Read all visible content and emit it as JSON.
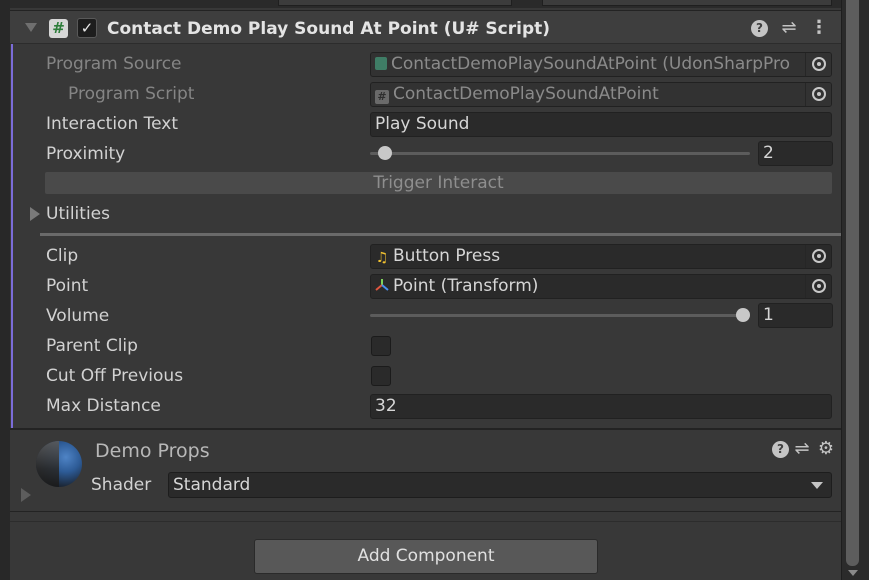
{
  "component": {
    "title": "Contact Demo Play Sound At Point (U# Script)",
    "enabled": true,
    "icons": {
      "script": "csharp-hash-icon",
      "help": "help-icon",
      "presets": "sliders-icon",
      "menu": "kebab-menu-icon"
    }
  },
  "udon": {
    "program_source_label": "Program Source",
    "program_source_value": "ContactDemoPlaySoundAtPoint (UdonSharpPro",
    "program_script_label": "Program Script",
    "program_script_value": "ContactDemoPlaySoundAtPoint",
    "interaction_text_label": "Interaction Text",
    "interaction_text_value": "Play Sound",
    "proximity_label": "Proximity",
    "proximity_value": "2",
    "trigger_button": "Trigger Interact",
    "utilities_label": "Utilities"
  },
  "fields": {
    "clip_label": "Clip",
    "clip_value": "Button Press",
    "point_label": "Point",
    "point_value": "Point (Transform)",
    "volume_label": "Volume",
    "volume_value": "1",
    "parent_clip_label": "Parent Clip",
    "parent_clip_checked": false,
    "cut_off_label": "Cut Off Previous",
    "cut_off_checked": false,
    "max_distance_label": "Max Distance",
    "max_distance_value": "32"
  },
  "material": {
    "name": "Demo Props",
    "shader_label": "Shader",
    "shader_value": "Standard"
  },
  "add_component": "Add Component",
  "colors": {
    "accent": "#7b6cd8",
    "panel": "#383838",
    "field": "#2a2a2a"
  }
}
